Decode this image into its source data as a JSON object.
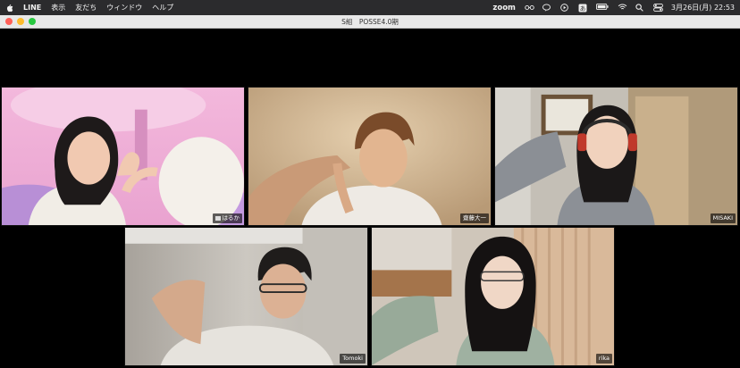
{
  "menubar": {
    "app_name": "LINE",
    "menus": [
      "表示",
      "友だち",
      "ウィンドウ",
      "ヘルプ"
    ],
    "zoom_label": "zoom",
    "datetime": "3月26日(月)  22:53"
  },
  "window": {
    "title": "S組　POSSE4.0期"
  },
  "participants": [
    {
      "name": "はるか",
      "name_icon": "flag-icon"
    },
    {
      "name": "齋藤大一"
    },
    {
      "name": "MISAKI"
    },
    {
      "name": "Tomoki"
    },
    {
      "name": "rika"
    }
  ],
  "colors": {
    "menubar_bg": "#2b2b2d",
    "titlebar_bg": "#e8e8e8",
    "close": "#ff5f57",
    "minimize": "#febc2e",
    "maximize": "#28c840"
  }
}
